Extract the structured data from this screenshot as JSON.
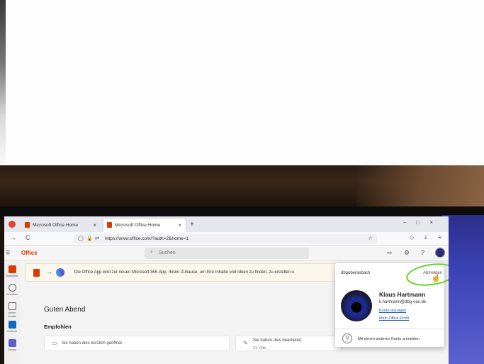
{
  "browser": {
    "tabs": [
      {
        "label": "Microsoft Office Home",
        "close": "×"
      },
      {
        "label": "Microsoft Office Home",
        "close": "×"
      }
    ],
    "new_tab": "+",
    "window_controls": "–□×",
    "url": "https://www.office.com/?auth=2&home=1",
    "back": "←",
    "forward": "→",
    "reload": "C"
  },
  "office": {
    "app_name": "Office",
    "search_placeholder": "Suchen",
    "banner_text": "Die Office App wird zur neuen Microsoft 365-App. Ihrem Zuhause, um Ihre Inhalte und Ideen zu finden, zu erstellen u",
    "greeting": "Guten Abend",
    "section_title": "Empfohlen",
    "card1_text": "Sie haben dies kürzlich geöffnet.",
    "card2_text": "Sie haben dies bearbeitet.",
    "card2_date": "21. Okt.",
    "rail": [
      {
        "label": "Startseite"
      },
      {
        "label": "Erstellen"
      },
      {
        "label": "Meine Inhalte"
      },
      {
        "label": "Outlook"
      },
      {
        "label": "Teams"
      }
    ]
  },
  "account": {
    "org": "dbgoberasbach",
    "sign_out": "Abmelden",
    "name": "Klaus Hartmann",
    "email": "k.hartmann@dbg-oas.de",
    "view_account": "Konto anzeigen",
    "office_profile": "Mein Office-Profil",
    "other_account": "Mit einem anderen Konto anmelden"
  },
  "colors": {
    "office_brand": "#d83b01",
    "annotation_circle": "#5fd21f",
    "link": "#2359b7"
  }
}
